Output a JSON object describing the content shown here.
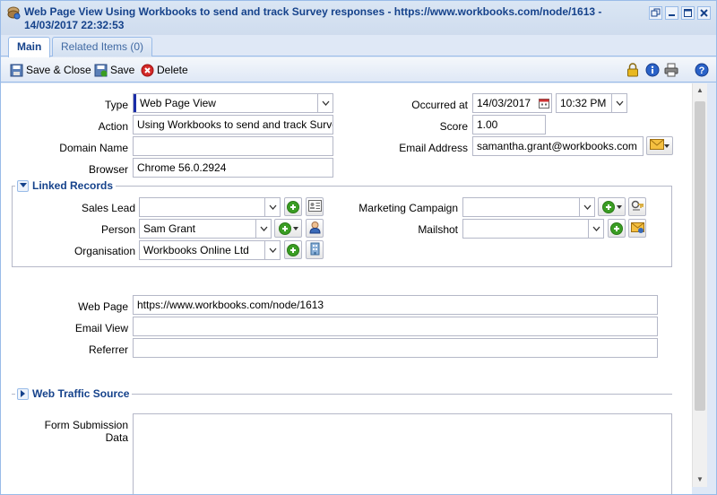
{
  "window": {
    "title": "Web Page View Using Workbooks to send and track Survey responses - https://www.workbooks.com/node/1613 - 14/03/2017 22:32:53"
  },
  "tabs": [
    {
      "label": "Main"
    },
    {
      "label": "Related Items (0)"
    }
  ],
  "toolbar": {
    "save_close_label": "Save & Close",
    "save_label": "Save",
    "delete_label": "Delete"
  },
  "form": {
    "type_label": "Type",
    "type_value": "Web Page View",
    "action_label": "Action",
    "action_value": "Using Workbooks to send and track Survey re",
    "domain_label": "Domain Name",
    "domain_value": "",
    "browser_label": "Browser",
    "browser_value": "Chrome 56.0.2924",
    "occurred_label": "Occurred at",
    "occurred_date": "14/03/2017",
    "occurred_time": "10:32 PM",
    "score_label": "Score",
    "score_value": "1.00",
    "email_label": "Email Address",
    "email_value": "samantha.grant@workbooks.com"
  },
  "linked": {
    "legend": "Linked Records",
    "sales_lead_label": "Sales Lead",
    "sales_lead_value": "",
    "person_label": "Person",
    "person_value": "Sam Grant",
    "organisation_label": "Organisation",
    "organisation_value": "Workbooks Online Ltd",
    "marketing_campaign_label": "Marketing Campaign",
    "marketing_campaign_value": "",
    "mailshot_label": "Mailshot",
    "mailshot_value": ""
  },
  "web": {
    "web_page_label": "Web Page",
    "web_page_value": "https://www.workbooks.com/node/1613",
    "email_view_label": "Email View",
    "email_view_value": "",
    "referrer_label": "Referrer",
    "referrer_value": ""
  },
  "traffic": {
    "legend": "Web Traffic Source"
  },
  "form_submission": {
    "label": "Form Submission Data",
    "value": ""
  },
  "colors": {
    "title": "#15428b",
    "border": "#99bbe8",
    "background": "#dfe8f6",
    "delete_red": "#d42a2a",
    "add_green": "#3a9d23"
  },
  "icons": [
    "app-icon",
    "restore-icon",
    "minimize-icon",
    "maximize-icon",
    "close-icon",
    "save-close-icon",
    "save-icon",
    "delete-icon",
    "lock-icon",
    "info-icon",
    "print-icon",
    "help-icon",
    "calendar-icon",
    "envelope-icon",
    "contact-card-icon",
    "person-icon",
    "building-icon",
    "campaign-icon",
    "mailshot-icon",
    "collapse-icon",
    "expand-icon"
  ]
}
